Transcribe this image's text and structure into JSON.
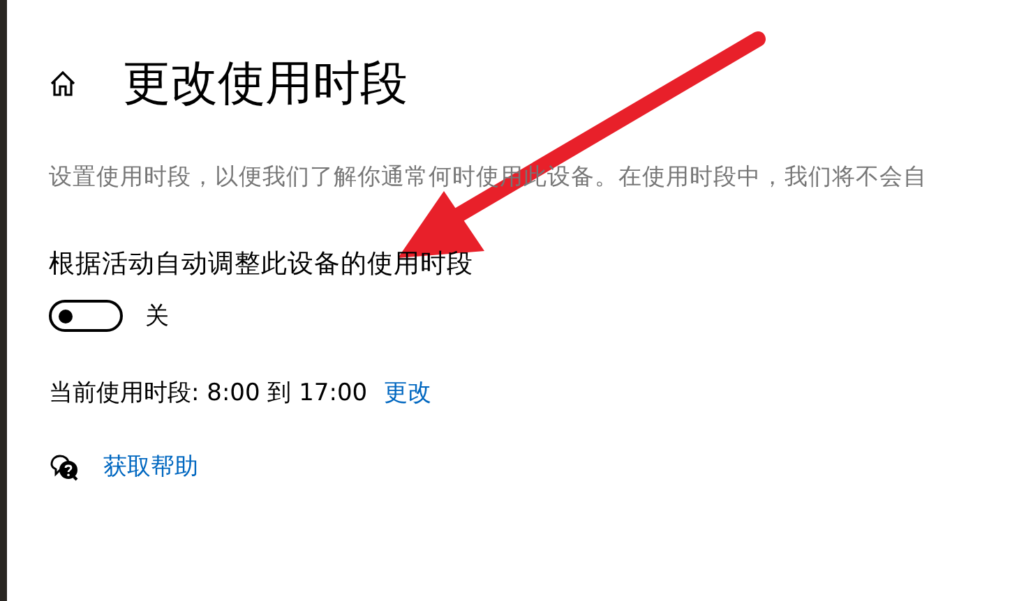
{
  "page": {
    "title": "更改使用时段",
    "description": "设置使用时段，以便我们了解你通常何时使用此设备。在使用时段中，我们将不会自"
  },
  "auto_adjust": {
    "label": "根据活动自动调整此设备的使用时段",
    "on": false,
    "state_text": "关"
  },
  "current_hours": {
    "label": "当前使用时段: 8:00 到 17:00",
    "link": "更改"
  },
  "help": {
    "link": "获取帮助"
  }
}
